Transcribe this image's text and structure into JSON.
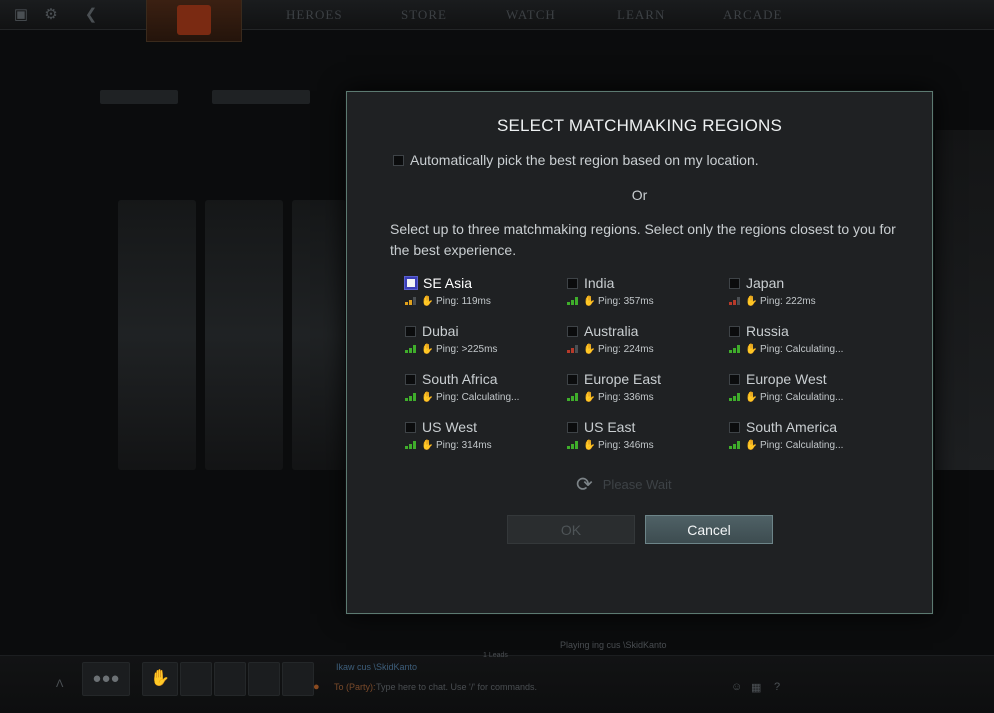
{
  "nav": {
    "items": [
      "HEROES",
      "STORE",
      "WATCH",
      "LEARN",
      "ARCADE"
    ]
  },
  "dialog": {
    "title": "SELECT MATCHMAKING REGIONS",
    "auto_pick_label": "Automatically pick the best region based on my location.",
    "or_text": "Or",
    "instructions": "Select up to three matchmaking regions. Select only the regions closest to you for the best experience.",
    "regions": [
      {
        "name": "SE Asia",
        "ping": "Ping: 119ms",
        "signal": 2,
        "signal_color": "#e0a11c",
        "focused": true
      },
      {
        "name": "India",
        "ping": "Ping: 357ms",
        "signal": 3,
        "signal_color": "#3fae2b"
      },
      {
        "name": "Japan",
        "ping": "Ping: 222ms",
        "signal": 2,
        "signal_color": "#b73a2a"
      },
      {
        "name": "Dubai",
        "ping": "Ping: >225ms",
        "signal": 3,
        "signal_color": "#3fae2b",
        "icon": "warning-hand-icon"
      },
      {
        "name": "Australia",
        "ping": "Ping: 224ms",
        "signal": 2,
        "signal_color": "#b73a2a"
      },
      {
        "name": "Russia",
        "ping": "Ping: Calculating...",
        "signal": 3,
        "signal_color": "#3fae2b"
      },
      {
        "name": "South Africa",
        "ping": "Ping: Calculating...",
        "signal": 3,
        "signal_color": "#3fae2b"
      },
      {
        "name": "Europe East",
        "ping": "Ping: 336ms",
        "signal": 3,
        "signal_color": "#3fae2b"
      },
      {
        "name": "Europe West",
        "ping": "Ping: Calculating...",
        "signal": 3,
        "signal_color": "#3fae2b"
      },
      {
        "name": "US West",
        "ping": "Ping: 314ms",
        "signal": 3,
        "signal_color": "#3fae2b"
      },
      {
        "name": "US East",
        "ping": "Ping: 346ms",
        "signal": 3,
        "signal_color": "#3fae2b"
      },
      {
        "name": "South America",
        "ping": "Ping: Calculating...",
        "signal": 3,
        "signal_color": "#3fae2b"
      }
    ],
    "wait_text": "Please Wait",
    "ok_label": "OK",
    "cancel_label": "Cancel"
  },
  "bottom": {
    "playing_text": "Playing ing cus \\SkidKanto",
    "count_text": "1 Leads",
    "user_line": "Ikaw cus \\SkidKanto",
    "chat_prefix": "To (Party):",
    "chat_placeholder": "Type here to chat. Use '/' for commands."
  },
  "colors": {
    "dialog_border": "#5c7a71",
    "cancel_button": "#4f6166",
    "signal_good": "#3fae2b",
    "signal_medium": "#e0a11c",
    "signal_bad": "#b73a2a"
  }
}
